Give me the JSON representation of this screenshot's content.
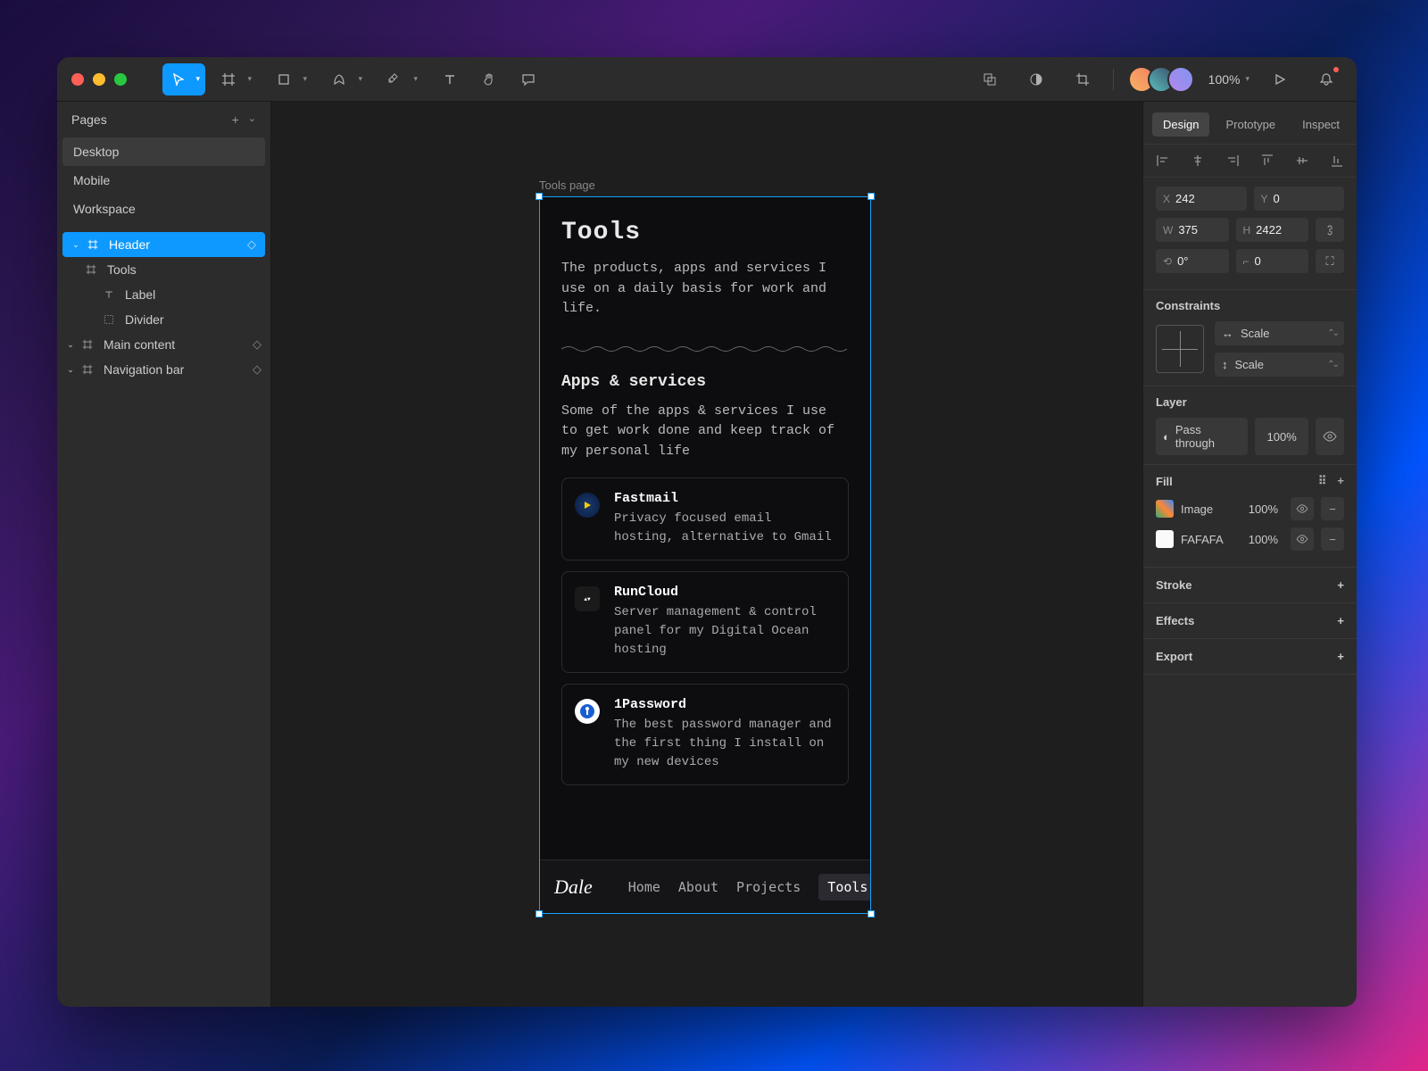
{
  "pages": {
    "title": "Pages",
    "items": [
      "Desktop",
      "Mobile",
      "Workspace"
    ],
    "active": "Desktop"
  },
  "layers": {
    "header": {
      "label": "Header"
    },
    "tools": {
      "label": "Tools"
    },
    "label": {
      "label": "Label"
    },
    "divider": {
      "label": "Divider"
    },
    "main": {
      "label": "Main content"
    },
    "nav": {
      "label": "Navigation bar"
    }
  },
  "frame": {
    "label": "Tools page",
    "title": "Tools",
    "subtitle": "The products, apps and services I use on a daily basis for work and life.",
    "section_title": "Apps & services",
    "section_sub": "Some of the apps & services I use to get work done and keep track of my personal life",
    "cards": [
      {
        "name": "Fastmail",
        "desc": "Privacy focused email hosting, alternative to Gmail"
      },
      {
        "name": "RunCloud",
        "desc": "Server management & control panel for my Digital Ocean hosting"
      },
      {
        "name": "1Password",
        "desc": "The best password manager and the first thing I install on my new devices"
      }
    ],
    "nav": {
      "brand": "Dale",
      "links": [
        "Home",
        "About",
        "Projects",
        "Tools"
      ],
      "active": "Tools"
    }
  },
  "zoom": "100%",
  "inspector": {
    "tabs": [
      "Design",
      "Prototype",
      "Inspect"
    ],
    "x": "242",
    "y": "0",
    "w": "375",
    "h": "2422",
    "r": "0°",
    "rr": "0",
    "constraints": {
      "title": "Constraints",
      "h": "Scale",
      "v": "Scale"
    },
    "layer": {
      "title": "Layer",
      "blend": "Pass through",
      "opacity": "100%"
    },
    "fill": {
      "title": "Fill",
      "items": [
        {
          "label": "Image",
          "opacity": "100%",
          "swatch": "image"
        },
        {
          "label": "FAFAFA",
          "opacity": "100%",
          "swatch": "#FAFAFA"
        }
      ]
    },
    "stroke": "Stroke",
    "effects": "Effects",
    "export": "Export"
  }
}
